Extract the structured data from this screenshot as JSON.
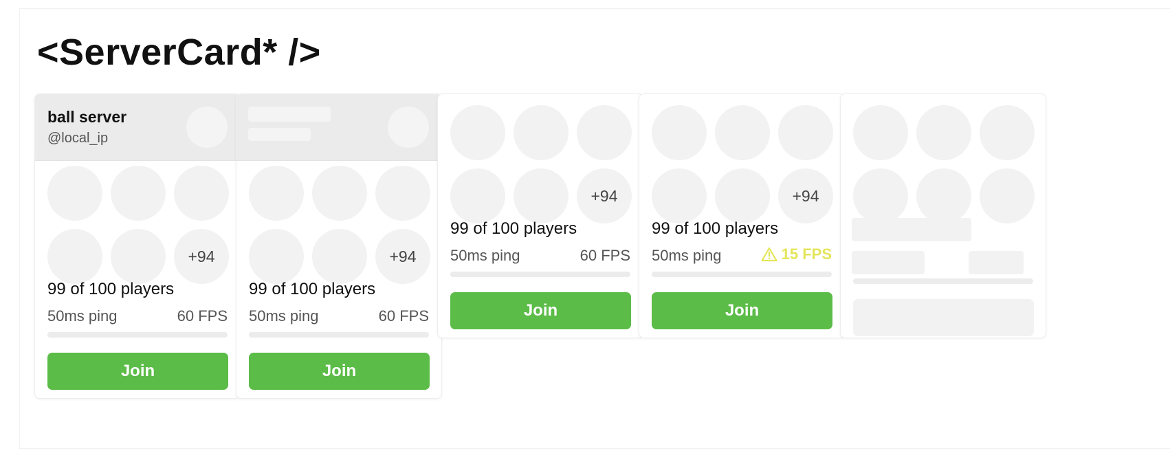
{
  "page": {
    "title": "<ServerCard* />"
  },
  "cards": [
    {
      "variant": "full",
      "header": {
        "name": "ball server",
        "handle": "@local_ip"
      },
      "overflow_count": "+94",
      "players_text": "99 of 100 players",
      "ping_text": "50ms ping",
      "fps_text": "60 FPS",
      "fps_warning": false,
      "player_fill_fraction": 0.99,
      "join_label": "Join"
    },
    {
      "variant": "header-loading",
      "overflow_count": "+94",
      "players_text": "99 of 100 players",
      "ping_text": "50ms ping",
      "fps_text": "60 FPS",
      "fps_warning": false,
      "player_fill_fraction": 0.99,
      "join_label": "Join"
    },
    {
      "variant": "no-header",
      "overflow_count": "+94",
      "players_text": "99 of 100 players",
      "ping_text": "50ms ping",
      "fps_text": "60 FPS",
      "fps_warning": false,
      "player_fill_fraction": 0.99,
      "join_label": "Join"
    },
    {
      "variant": "no-header-warning",
      "overflow_count": "+94",
      "players_text": "99 of 100 players",
      "ping_text": "50ms ping",
      "fps_text": "15 FPS",
      "fps_warning": true,
      "player_fill_fraction": 0.99,
      "join_label": "Join"
    },
    {
      "variant": "skeleton"
    }
  ],
  "colors": {
    "join_button": "#5bbc47",
    "warning": "#e4e55a",
    "skeleton": "#f2f2f2"
  },
  "icons": {
    "fps_warning": "warning-triangle-icon"
  }
}
